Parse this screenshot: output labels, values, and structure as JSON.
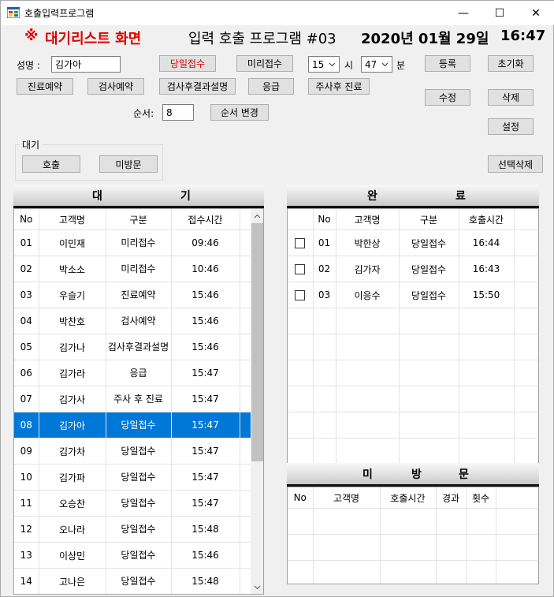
{
  "window": {
    "title": "호출입력프로그램",
    "minimize": "—",
    "maximize": "☐",
    "close": "✕"
  },
  "header": {
    "title_mark": "※",
    "title": "대기리스트 화면",
    "program": "입력 호출 프로그램 #03",
    "date": "2020년 01월 29일",
    "time": "16:47"
  },
  "form": {
    "name_label": "성명 :",
    "name_value": "김가아",
    "same_day_btn": "당일접수",
    "pre_btn": "미리접수",
    "hour_value": "15",
    "hour_label": "시",
    "minute_value": "47",
    "minute_label": "분",
    "register_btn": "등록",
    "reset_btn": "초기화",
    "reservation_btn": "진료예약",
    "exam_reservation_btn": "검사예약",
    "exam_result_btn": "검사후결과설명",
    "emergency_btn": "응급",
    "injection_btn": "주사후 진료",
    "edit_btn": "수정",
    "delete_btn": "삭제",
    "settings_btn": "설정",
    "order_label": "순서:",
    "order_value": "8",
    "order_change_btn": "순서 변경",
    "wait_group_label": "대기",
    "call_btn": "호출",
    "no_visit_btn": "미방문",
    "selected_delete_btn": "선택삭제"
  },
  "wait_panel": {
    "title_a": "대",
    "title_b": "기",
    "columns": [
      "No",
      "고객명",
      "구분",
      "접수시간"
    ],
    "rows": [
      {
        "no": "01",
        "name": "이민재",
        "type": "미리접수",
        "time": "09:46"
      },
      {
        "no": "02",
        "name": "박소소",
        "type": "미리접수",
        "time": "10:46"
      },
      {
        "no": "03",
        "name": "우슬기",
        "type": "진료예약",
        "time": "15:46"
      },
      {
        "no": "04",
        "name": "박찬호",
        "type": "검사예약",
        "time": "15:46"
      },
      {
        "no": "05",
        "name": "김가나",
        "type": "검사후결과설명",
        "time": "15:46"
      },
      {
        "no": "06",
        "name": "김가라",
        "type": "응급",
        "time": "15:47"
      },
      {
        "no": "07",
        "name": "김가사",
        "type": "주사 후 진료",
        "time": "15:47"
      },
      {
        "no": "08",
        "name": "김가아",
        "type": "당일접수",
        "time": "15:47"
      },
      {
        "no": "09",
        "name": "김가차",
        "type": "당일접수",
        "time": "15:47"
      },
      {
        "no": "10",
        "name": "김가파",
        "type": "당일접수",
        "time": "15:47"
      },
      {
        "no": "11",
        "name": "오승찬",
        "type": "당일접수",
        "time": "15:47"
      },
      {
        "no": "12",
        "name": "오나라",
        "type": "당일접수",
        "time": "15:48"
      },
      {
        "no": "13",
        "name": "이상민",
        "type": "당일접수",
        "time": "15:46"
      },
      {
        "no": "14",
        "name": "고나은",
        "type": "당일접수",
        "time": "15:48"
      }
    ]
  },
  "done_panel": {
    "title_a": "완",
    "title_b": "료",
    "columns": [
      "",
      "No",
      "고객명",
      "구분",
      "호출시간"
    ],
    "rows": [
      {
        "no": "01",
        "name": "박한상",
        "type": "당일접수",
        "time": "16:44"
      },
      {
        "no": "02",
        "name": "김가자",
        "type": "당일접수",
        "time": "16:43"
      },
      {
        "no": "03",
        "name": "이응수",
        "type": "당일접수",
        "time": "15:50"
      }
    ]
  },
  "novisit_panel": {
    "title_a": "미",
    "title_b": "방",
    "title_c": "문",
    "columns": [
      "No",
      "고객명",
      "호출시간",
      "경과",
      "횟수"
    ]
  }
}
